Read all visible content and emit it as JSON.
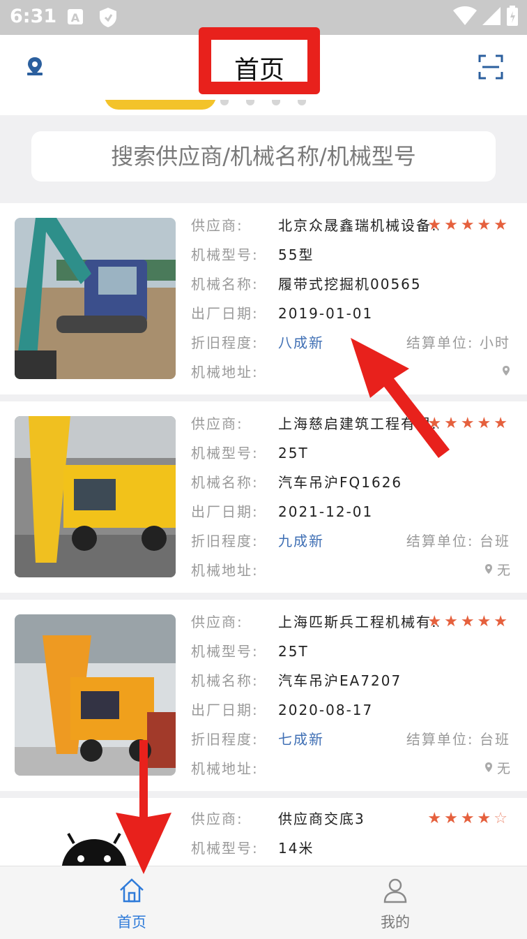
{
  "status_bar": {
    "time": "6:31"
  },
  "header": {
    "title": "首页"
  },
  "search": {
    "placeholder": "搜索供应商/机械名称/机械型号"
  },
  "labels": {
    "supplier": "供应商:",
    "model": "机械型号:",
    "name": "机械名称:",
    "date": "出厂日期:",
    "condition": "折旧程度:",
    "address": "机械地址:",
    "unit": "结算单位:"
  },
  "listings": [
    {
      "supplier": "北京众晟鑫瑞机械设备…",
      "rating": 5,
      "model": "55型",
      "name": "履带式挖掘机00565",
      "date": "2019-01-01",
      "condition": "八成新",
      "unit": "小时",
      "address": ""
    },
    {
      "supplier": "上海慈启建筑工程有限…",
      "rating": 5,
      "model": "25T",
      "name": "汽车吊沪FQ1626",
      "date": "2021-12-01",
      "condition": "九成新",
      "unit": "台班",
      "address": "无"
    },
    {
      "supplier": "上海匹斯兵工程机械有…",
      "rating": 5,
      "model": "25T",
      "name": "汽车吊沪EA7207",
      "date": "2020-08-17",
      "condition": "七成新",
      "unit": "台班",
      "address": "无"
    },
    {
      "supplier": "供应商交底3",
      "rating": 4,
      "model": "14米"
    }
  ],
  "tabs": [
    {
      "label": "首页",
      "active": true,
      "icon": "home-icon"
    },
    {
      "label": "我的",
      "active": false,
      "icon": "person-icon"
    }
  ],
  "colors": {
    "accent": "#2f7bd9",
    "star": "#e5603d",
    "condition": "#3f6fb4",
    "annotation": "#e8211c"
  }
}
